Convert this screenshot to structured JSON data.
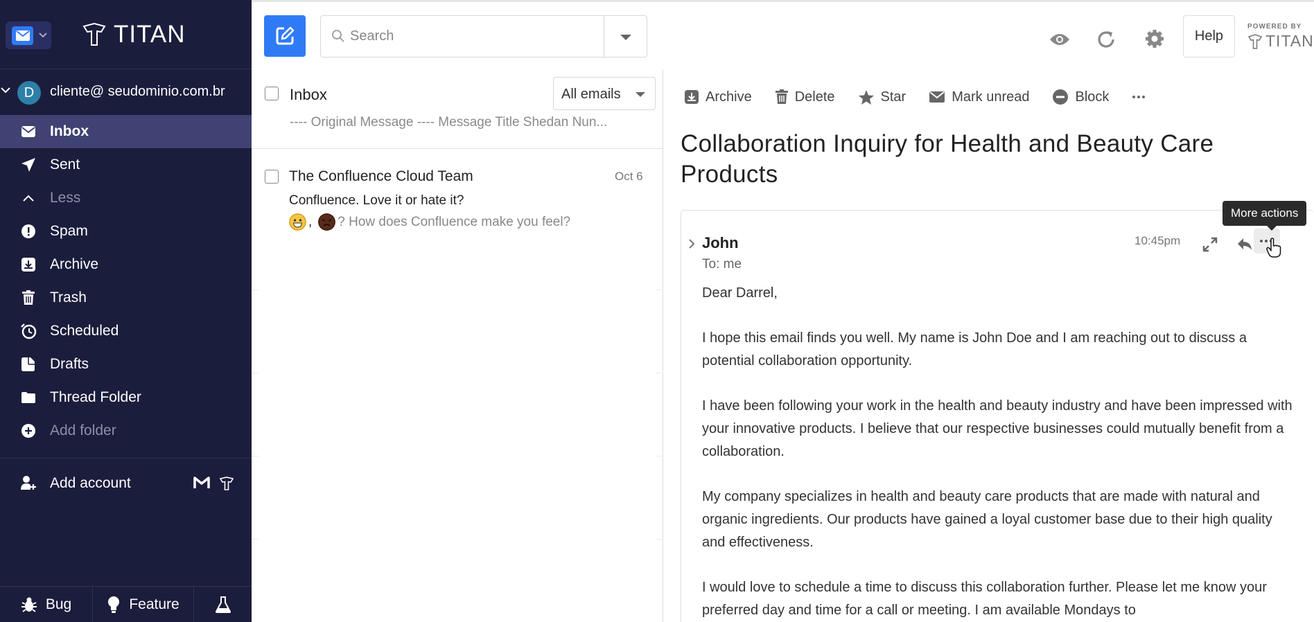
{
  "brand": {
    "name": "TITAN",
    "powered_by": "POWERED BY",
    "accent": "#2f7bf5",
    "sidebar_bg": "#1b1d3c"
  },
  "account": {
    "initial": "D",
    "email": "cliente@ seudominio.com.br"
  },
  "sidebar": {
    "items": [
      {
        "label": "Inbox",
        "icon": "inbox-icon",
        "active": true
      },
      {
        "label": "Sent",
        "icon": "paper-plane-icon"
      },
      {
        "label": "Less",
        "icon": "chevron-up-icon"
      },
      {
        "label": "Spam",
        "icon": "alert-circle-icon"
      },
      {
        "label": "Archive",
        "icon": "archive-icon"
      },
      {
        "label": "Trash",
        "icon": "trash-icon"
      },
      {
        "label": "Scheduled",
        "icon": "clock-icon"
      },
      {
        "label": "Drafts",
        "icon": "draft-icon"
      },
      {
        "label": "Thread Folder",
        "icon": "folder-icon"
      },
      {
        "label": "Add folder",
        "icon": "plus-circle-icon"
      }
    ],
    "add_account": "Add account",
    "bottom": {
      "bug": "Bug",
      "feature": "Feature"
    }
  },
  "topbar": {
    "search_placeholder": "Search",
    "help": "Help"
  },
  "list": {
    "title": "Inbox",
    "filter": "All emails",
    "prev_snippet": "---- Original Message ---- Message Title Shedan Nun...",
    "emails": [
      {
        "from": "The Confluence Cloud Team",
        "date": "Oct 6",
        "subject": "Confluence. Love it or hate it?",
        "preview_sep": ",",
        "preview_text": "? How does Confluence make you feel?"
      }
    ]
  },
  "reader": {
    "actions": {
      "archive": "Archive",
      "delete": "Delete",
      "star": "Star",
      "mark_unread": "Mark unread",
      "block": "Block"
    },
    "subject": "Collaboration Inquiry for Health and Beauty Care Products",
    "message": {
      "from": "John",
      "to": "To: me",
      "time": "10:45pm",
      "body": [
        "Dear Darrel,",
        "I hope this email finds you well. My name is John Doe and I am reaching out to discuss a potential collaboration opportunity.",
        "I have been following your work in the health and beauty industry and have been impressed with your innovative products. I believe that our respective businesses could mutually benefit from a collaboration.",
        "My company specializes in health and beauty care products that are made with natural and organic ingredients. Our products have gained a loyal customer base due to their high quality and effectiveness.",
        "I would love to schedule a time to discuss this collaboration further. Please let me know your preferred day and time for a call or meeting. I am available Mondays to"
      ]
    },
    "tooltip": "More actions"
  }
}
